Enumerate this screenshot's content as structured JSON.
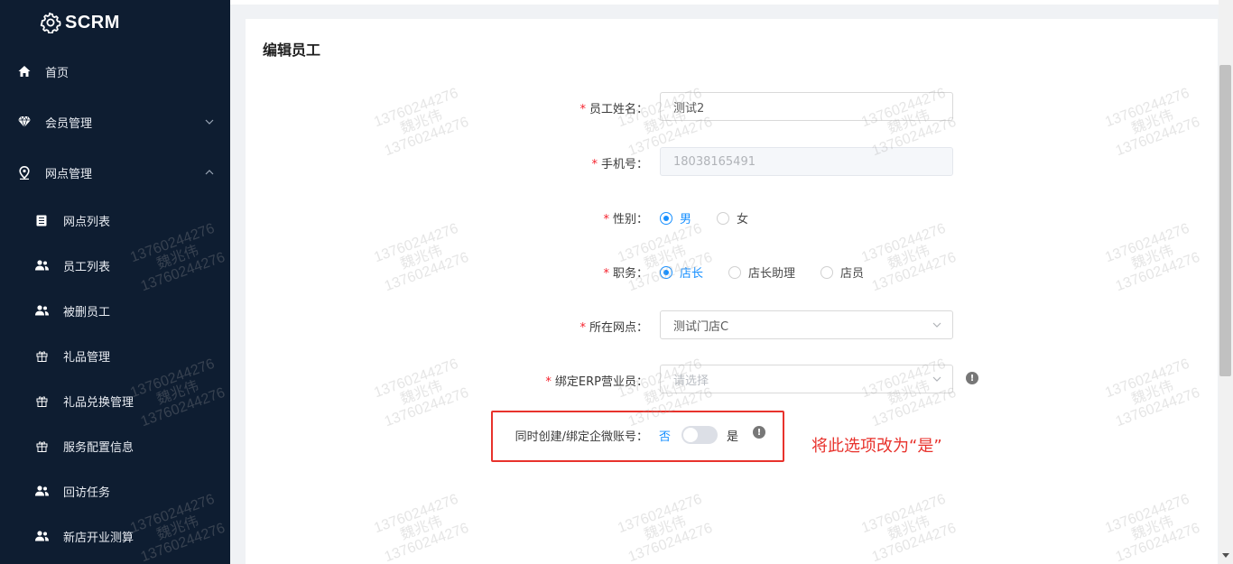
{
  "app": {
    "logo_text": "SCRM"
  },
  "sidebar": {
    "items": [
      {
        "label": "首页",
        "icon": "home-icon"
      },
      {
        "label": "会员管理",
        "icon": "diamond-icon"
      },
      {
        "label": "网点管理",
        "icon": "location-pin-icon"
      }
    ],
    "sub_items": [
      {
        "label": "网点列表",
        "icon": "list-icon"
      },
      {
        "label": "员工列表",
        "icon": "users-icon"
      },
      {
        "label": "被删员工",
        "icon": "users-icon"
      },
      {
        "label": "礼品管理",
        "icon": "gift-icon"
      },
      {
        "label": "礼品兑换管理",
        "icon": "gift-icon"
      },
      {
        "label": "服务配置信息",
        "icon": "gift-icon"
      },
      {
        "label": "回访任务",
        "icon": "users-icon"
      },
      {
        "label": "新店开业测算",
        "icon": "users-icon"
      }
    ]
  },
  "page": {
    "title": "编辑员工"
  },
  "form": {
    "required_mark": "*",
    "name": {
      "label": "员工姓名：",
      "value": "测试2"
    },
    "phone": {
      "label": "手机号：",
      "value": "18038165491"
    },
    "gender": {
      "label": "性别：",
      "options": [
        "男",
        "女"
      ],
      "selected": "男"
    },
    "role": {
      "label": "职务：",
      "options": [
        "店长",
        "店长助理",
        "店员"
      ],
      "selected": "店长"
    },
    "outlet": {
      "label": "所在网点：",
      "value": "测试门店C"
    },
    "erp": {
      "label": "绑定ERP营业员：",
      "placeholder": "请选择",
      "info_icon": "!"
    },
    "wecom": {
      "label": "同时创建/绑定企微账号：",
      "off_label": "否",
      "on_label": "是",
      "state": "off",
      "info_icon": "!"
    }
  },
  "annotation": {
    "text": "将此选项改为“是”"
  },
  "watermark": {
    "line1": "13760244276",
    "line2": "魏兆伟",
    "line3": "13760244276"
  },
  "colors": {
    "sidebar_bg": "#0e1d31",
    "primary": "#1890ff",
    "annotation": "#e8322c"
  }
}
